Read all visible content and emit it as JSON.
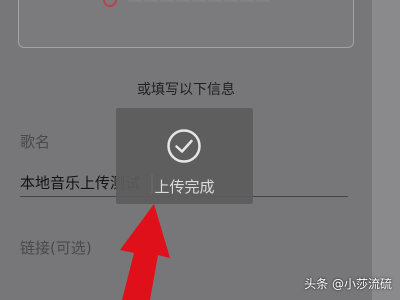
{
  "top_card": {
    "text": "—————————"
  },
  "section_hint": "或填写以下信息",
  "fields": {
    "name_label": "歌名",
    "name_value": "本地音乐上传测试",
    "link_label": "链接(可选)"
  },
  "toast": {
    "text": "上传完成",
    "icon": "check-circle-icon"
  },
  "watermark": "头条 @小莎流硫",
  "colors": {
    "overlay": "#777678",
    "arrow": "#e0101a",
    "accent_icon": "#b8454b"
  }
}
